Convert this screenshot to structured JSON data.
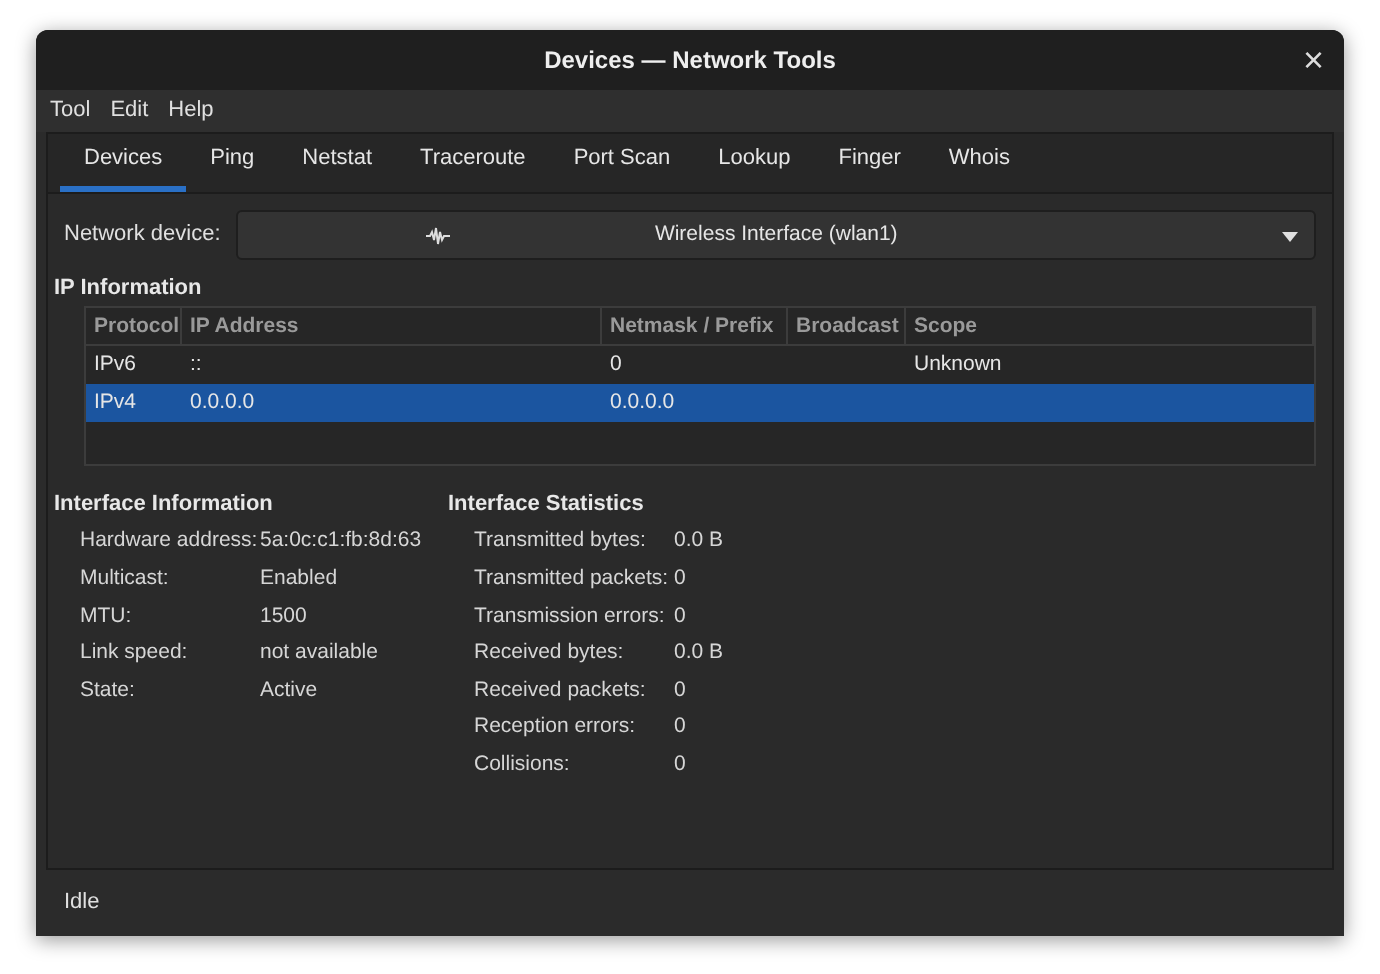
{
  "window": {
    "title": "Devices — Network Tools",
    "close": "×"
  },
  "menu": [
    "Tool",
    "Edit",
    "Help"
  ],
  "tabs": [
    {
      "label": "Devices",
      "selected": true
    },
    {
      "label": "Ping",
      "selected": false
    },
    {
      "label": "Netstat",
      "selected": false
    },
    {
      "label": "Traceroute",
      "selected": false
    },
    {
      "label": "Port Scan",
      "selected": false
    },
    {
      "label": "Lookup",
      "selected": false
    },
    {
      "label": "Finger",
      "selected": false
    },
    {
      "label": "Whois",
      "selected": false
    }
  ],
  "device": {
    "label": "Network device:",
    "value": "Wireless Interface (wlan1)"
  },
  "ip_info": {
    "title": "IP Information",
    "columns": [
      "Protocol",
      "IP Address",
      "Netmask / Prefix",
      "Broadcast",
      "Scope"
    ],
    "rows": [
      {
        "cells": [
          "IPv6",
          "::",
          "0",
          "",
          "Unknown"
        ],
        "selected": false
      },
      {
        "cells": [
          "IPv4",
          "0.0.0.0",
          "0.0.0.0",
          "",
          ""
        ],
        "selected": true
      }
    ]
  },
  "interface_info": {
    "title": "Interface Information",
    "rows": [
      [
        "Hardware address:",
        "5a:0c:c1:fb:8d:63"
      ],
      [
        "Multicast:",
        "Enabled"
      ],
      [
        "MTU:",
        "1500"
      ],
      [
        "Link speed:",
        "not available"
      ],
      [
        "State:",
        "Active"
      ]
    ]
  },
  "interface_stats": {
    "title": "Interface Statistics",
    "rows": [
      [
        "Transmitted bytes:",
        "0.0 B"
      ],
      [
        "Transmitted packets:",
        "0"
      ],
      [
        "Transmission errors:",
        "0"
      ],
      [
        "Received bytes:",
        "0.0 B"
      ],
      [
        "Received packets:",
        "0"
      ],
      [
        "Reception errors:",
        "0"
      ],
      [
        "Collisions:",
        "0"
      ]
    ]
  },
  "status_bar": "Idle"
}
